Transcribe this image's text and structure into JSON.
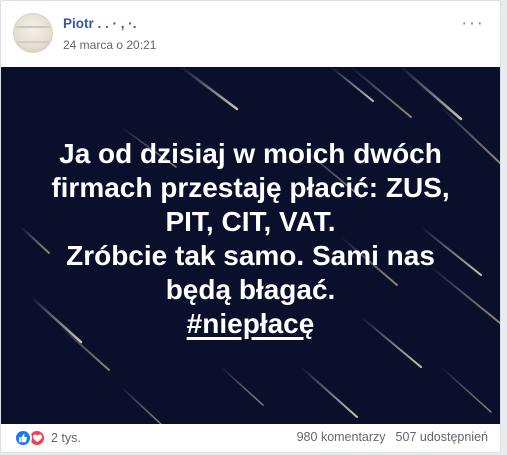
{
  "post": {
    "author_name": "Piotr . . ·       , ·.",
    "timestamp": "24 marca o 20:21",
    "more_label": "···",
    "image_text": {
      "lines": [
        "Ja od dzisiaj w moich dwóch",
        "firmach przestaję płacić: ZUS,",
        "PIT, CIT, VAT.",
        "Zróbcie tak samo. Sami nas",
        "będą błagać."
      ],
      "hashtag": "#niepłacę"
    },
    "reactions": {
      "icons": [
        "like-icon",
        "love-icon"
      ],
      "count": "2 tys."
    },
    "comments_label": "980 komentarzy",
    "shares_label": "507 udostępnień"
  },
  "colors": {
    "author_link": "#365899",
    "image_background": "#0a0f2c",
    "like": "#1877f2",
    "love": "#f33e58"
  }
}
